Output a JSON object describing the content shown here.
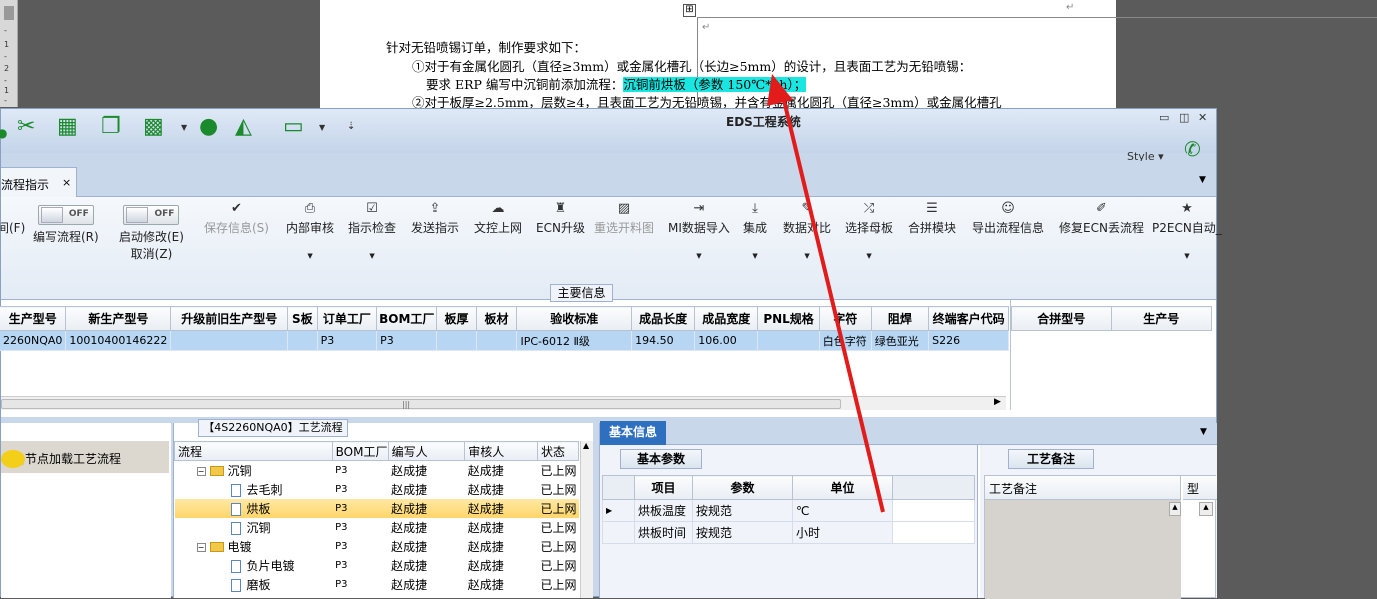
{
  "doc": {
    "line1": "针对无铅喷锡订单，制作要求如下：",
    "line2": "①对于有金属化圆孔（直径≥3mm）或金属化槽孔（长边≥5mm）的设计，且表面工艺为无铅喷锡：",
    "line3a": "要求 ERP 编写中沉铜前添加流程：",
    "line3b": "沉铜前烘板（参数 150℃*2h）；",
    "line4": "②对于板厚≥2.5mm，层数≥4，且表面工艺为无铅喷锡，并含有金属化圆孔（直径≥3mm）或金属化槽孔",
    "para_mark": "↵",
    "table_handle": "⊞"
  },
  "ruler": {
    "marks": [
      "-",
      "1",
      "-",
      "2",
      "-",
      "1",
      "-"
    ]
  },
  "app": {
    "title": "EDS工程系统",
    "style_label": "Style",
    "tab_label": "流程指示",
    "tab_close": "×",
    "toolbar_icons": [
      "scissors-icon",
      "film-icon",
      "copy-icon",
      "grid-icon",
      "user-icon",
      "chart-icon",
      "laptop-icon"
    ]
  },
  "ribbon": {
    "partial_left": "间(F)",
    "toggle_text": "OFF",
    "edit_flow": "编写流程(R)",
    "auto_modify": "启动修改(E)",
    "cancel": "取消(Z)",
    "save_info": "保存信息(S)",
    "internal_review": "内部审核",
    "send_check": "指示检查",
    "send_instr": "发送指示",
    "upload": "文控上网",
    "ecn_upgrade": "ECN升级",
    "reselect_img": "重选开料图",
    "mi_import": "MI数据导入",
    "integrate": "集成",
    "data_compare": "数据对比",
    "select_master": "选择母板",
    "merge_module": "合拼模块",
    "export_flow": "导出流程信息",
    "repair_ecn": "修复ECN丢流程",
    "p2ecn": "P2ECN自动_"
  },
  "main": {
    "title": "主要信息",
    "columns": [
      "生产型号",
      "新生产型号",
      "升级前旧生产型号",
      "S板",
      "订单工厂",
      "BOM工厂",
      "板厚",
      "板材",
      "验收标准",
      "成品长度",
      "成品宽度",
      "PNL规格",
      "字符",
      "阻焊",
      "终端客户代码"
    ],
    "row": [
      "2260NQA0",
      "10010400146222",
      "",
      "",
      "P3",
      "P3",
      "",
      "",
      "IPC-6012 Ⅱ级",
      "194.50",
      "106.00",
      "",
      "白色字符",
      "绿色亚光",
      "S226"
    ],
    "side_columns": [
      "合拼型号",
      "生产号"
    ],
    "scroll_grip": "|||"
  },
  "left": {
    "hint": "单击节点加载工艺流程"
  },
  "flow": {
    "title": "【4S2260NQA0】工艺流程",
    "columns": [
      "流程",
      "BOM工厂",
      "编写人",
      "审核人",
      "状态"
    ],
    "rows": [
      {
        "name": "沉铜",
        "level": 0,
        "factory": "P3",
        "writer": "赵成捷",
        "reviewer": "赵成捷",
        "status": "已上网"
      },
      {
        "name": "去毛刺",
        "level": 1,
        "factory": "P3",
        "writer": "赵成捷",
        "reviewer": "赵成捷",
        "status": "已上网"
      },
      {
        "name": "烘板",
        "level": 1,
        "factory": "P3",
        "writer": "赵成捷",
        "reviewer": "赵成捷",
        "status": "已上网"
      },
      {
        "name": "沉铜",
        "level": 1,
        "factory": "P3",
        "writer": "赵成捷",
        "reviewer": "赵成捷",
        "status": "已上网"
      },
      {
        "name": "电镀",
        "level": 0,
        "factory": "P3",
        "writer": "赵成捷",
        "reviewer": "赵成捷",
        "status": "已上网"
      },
      {
        "name": "负片电镀",
        "level": 1,
        "factory": "P3",
        "writer": "赵成捷",
        "reviewer": "赵成捷",
        "status": "已上网"
      },
      {
        "name": "磨板",
        "level": 1,
        "factory": "P3",
        "writer": "赵成捷",
        "reviewer": "赵成捷",
        "status": "已上网"
      }
    ]
  },
  "basic": {
    "tab": "基本信息",
    "subtab": "基本参数",
    "columns": [
      "项目",
      "参数",
      "单位"
    ],
    "rows": [
      {
        "item": "烘板温度",
        "param": "按规范",
        "unit": "℃"
      },
      {
        "item": "烘板时间",
        "param": "按规范",
        "unit": "小时"
      }
    ],
    "notes_tab": "工艺备注",
    "notes_header": "工艺备注",
    "notes_header2": "型"
  },
  "colors": {
    "highlight": "#19e6e0",
    "accent": "#2e6fc0",
    "arrow": "#e21b1b",
    "green": "#1a8a2c"
  }
}
